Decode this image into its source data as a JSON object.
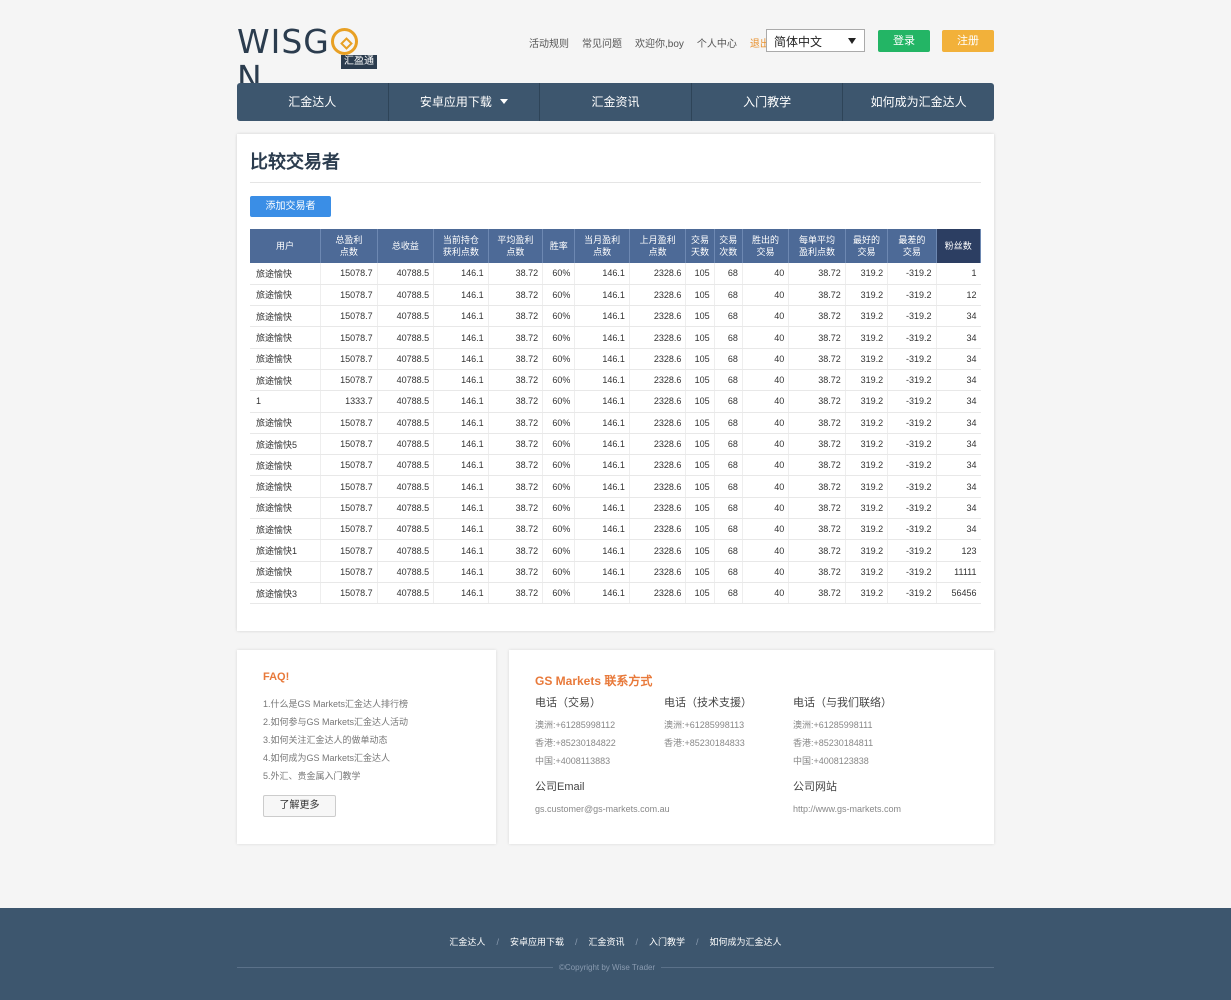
{
  "header": {
    "logo_text": "WISG",
    "logo_text_end": "N",
    "logo_sub": "汇盈通",
    "links": [
      "活动规则",
      "常见问题",
      "欢迎你,boy",
      "个人中心"
    ],
    "logout": "退出",
    "language": "简体中文",
    "login": "登录",
    "register": "注册"
  },
  "nav": [
    "汇金达人",
    "安卓应用下载",
    "汇金资讯",
    "入门教学",
    "如何成为汇金达人"
  ],
  "main": {
    "title": "比较交易者",
    "add_button": "添加交易者",
    "columns": [
      "用户",
      "总盈利点数",
      "总收益",
      "当前持仓获利点数",
      "平均盈利点数",
      "胜率",
      "当月盈利点数",
      "上月盈利点数",
      "交易天数",
      "交易次数",
      "胜出的交易",
      "每单平均盈利点数",
      "最好的交易",
      "最差的交易",
      "粉丝数"
    ],
    "columns_display": [
      [
        "用户",
        ""
      ],
      [
        "总盈利",
        "点数"
      ],
      [
        "总收益",
        ""
      ],
      [
        "当前持仓",
        "获利点数"
      ],
      [
        "平均盈利",
        "点数"
      ],
      [
        "胜率",
        ""
      ],
      [
        "当月盈利",
        "点数"
      ],
      [
        "上月盈利",
        "点数"
      ],
      [
        "交易",
        "天数"
      ],
      [
        "交易",
        "次数"
      ],
      [
        "胜出的",
        "交易"
      ],
      [
        "每单平均",
        "盈利点数"
      ],
      [
        "最好的",
        "交易"
      ],
      [
        "最差的",
        "交易"
      ],
      [
        "粉丝数",
        ""
      ]
    ],
    "rows": [
      [
        "旅途愉快",
        "15078.7",
        "40788.5",
        "146.1",
        "38.72",
        "60%",
        "146.1",
        "2328.6",
        "105",
        "68",
        "40",
        "38.72",
        "319.2",
        "-319.2",
        "1"
      ],
      [
        "旅途愉快",
        "15078.7",
        "40788.5",
        "146.1",
        "38.72",
        "60%",
        "146.1",
        "2328.6",
        "105",
        "68",
        "40",
        "38.72",
        "319.2",
        "-319.2",
        "12"
      ],
      [
        "旅途愉快",
        "15078.7",
        "40788.5",
        "146.1",
        "38.72",
        "60%",
        "146.1",
        "2328.6",
        "105",
        "68",
        "40",
        "38.72",
        "319.2",
        "-319.2",
        "34"
      ],
      [
        "旅途愉快",
        "15078.7",
        "40788.5",
        "146.1",
        "38.72",
        "60%",
        "146.1",
        "2328.6",
        "105",
        "68",
        "40",
        "38.72",
        "319.2",
        "-319.2",
        "34"
      ],
      [
        "旅途愉快",
        "15078.7",
        "40788.5",
        "146.1",
        "38.72",
        "60%",
        "146.1",
        "2328.6",
        "105",
        "68",
        "40",
        "38.72",
        "319.2",
        "-319.2",
        "34"
      ],
      [
        "旅途愉快",
        "15078.7",
        "40788.5",
        "146.1",
        "38.72",
        "60%",
        "146.1",
        "2328.6",
        "105",
        "68",
        "40",
        "38.72",
        "319.2",
        "-319.2",
        "34"
      ],
      [
        "1",
        "1333.7",
        "40788.5",
        "146.1",
        "38.72",
        "60%",
        "146.1",
        "2328.6",
        "105",
        "68",
        "40",
        "38.72",
        "319.2",
        "-319.2",
        "34"
      ],
      [
        "旅途愉快",
        "15078.7",
        "40788.5",
        "146.1",
        "38.72",
        "60%",
        "146.1",
        "2328.6",
        "105",
        "68",
        "40",
        "38.72",
        "319.2",
        "-319.2",
        "34"
      ],
      [
        "旅途愉快5",
        "15078.7",
        "40788.5",
        "146.1",
        "38.72",
        "60%",
        "146.1",
        "2328.6",
        "105",
        "68",
        "40",
        "38.72",
        "319.2",
        "-319.2",
        "34"
      ],
      [
        "旅途愉快",
        "15078.7",
        "40788.5",
        "146.1",
        "38.72",
        "60%",
        "146.1",
        "2328.6",
        "105",
        "68",
        "40",
        "38.72",
        "319.2",
        "-319.2",
        "34"
      ],
      [
        "旅途愉快",
        "15078.7",
        "40788.5",
        "146.1",
        "38.72",
        "60%",
        "146.1",
        "2328.6",
        "105",
        "68",
        "40",
        "38.72",
        "319.2",
        "-319.2",
        "34"
      ],
      [
        "旅途愉快",
        "15078.7",
        "40788.5",
        "146.1",
        "38.72",
        "60%",
        "146.1",
        "2328.6",
        "105",
        "68",
        "40",
        "38.72",
        "319.2",
        "-319.2",
        "34"
      ],
      [
        "旅途愉快",
        "15078.7",
        "40788.5",
        "146.1",
        "38.72",
        "60%",
        "146.1",
        "2328.6",
        "105",
        "68",
        "40",
        "38.72",
        "319.2",
        "-319.2",
        "34"
      ],
      [
        "旅途愉快1",
        "15078.7",
        "40788.5",
        "146.1",
        "38.72",
        "60%",
        "146.1",
        "2328.6",
        "105",
        "68",
        "40",
        "38.72",
        "319.2",
        "-319.2",
        "123"
      ],
      [
        "旅途愉快",
        "15078.7",
        "40788.5",
        "146.1",
        "38.72",
        "60%",
        "146.1",
        "2328.6",
        "105",
        "68",
        "40",
        "38.72",
        "319.2",
        "-319.2",
        "11111"
      ],
      [
        "旅途愉快3",
        "15078.7",
        "40788.5",
        "146.1",
        "38.72",
        "60%",
        "146.1",
        "2328.6",
        "105",
        "68",
        "40",
        "38.72",
        "319.2",
        "-319.2",
        "56456"
      ]
    ]
  },
  "faq": {
    "title": "FAQ!",
    "items": [
      "1.什么是GS Markets汇金达人排行榜",
      "2.如何参与GS Markets汇金达人活动",
      "3.如何关注汇金达人的做单动态",
      "4.如何成为GS Markets汇金达人",
      "5.外汇、贵金属入门教学"
    ],
    "more": "了解更多"
  },
  "contact": {
    "title": "GS Markets 联系方式",
    "columns": [
      {
        "heading": "电话（交易）",
        "lines": [
          "澳洲:+61285998112",
          "香港:+85230184822",
          "中国:+4008113883"
        ]
      },
      {
        "heading": "电话（技术支援）",
        "lines": [
          "澳洲:+61285998113",
          "香港:+85230184833"
        ]
      },
      {
        "heading": "电话（与我们联络）",
        "lines": [
          "澳洲:+61285998111",
          "香港:+85230184811",
          "中国:+4008123838"
        ]
      }
    ],
    "email_heading": "公司Email",
    "email": "gs.customer@gs-markets.com.au",
    "site_heading": "公司网站",
    "site": "http://www.gs-markets.com"
  },
  "footer": {
    "links": [
      "汇金达人",
      "安卓应用下载",
      "汇金资讯",
      "入门教学",
      "如何成为汇金达人"
    ],
    "separator": "/",
    "copyright": "©Copyright by Wise Trader"
  },
  "colors": {
    "nav": "#3d566e",
    "table_header": "#4d6a97",
    "login": "#23b565",
    "register": "#f2b13a",
    "accent": "#e8793a"
  }
}
